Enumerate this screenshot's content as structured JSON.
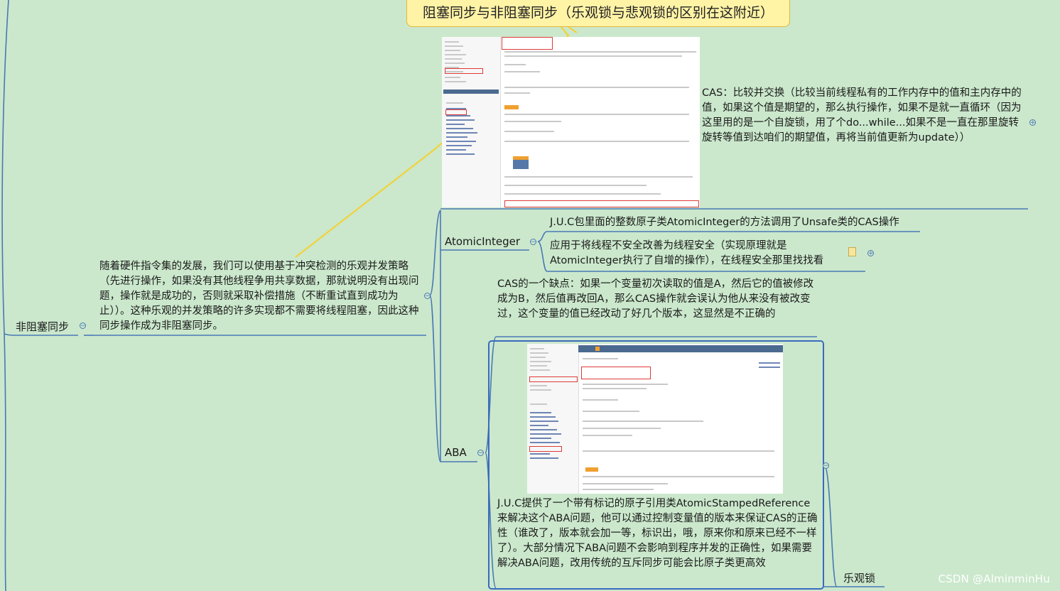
{
  "title": "阻塞同步与非阻塞同步（乐观锁与悲观锁的区别在这附近）",
  "left_node": {
    "label": "非阻塞同步"
  },
  "description": "随着硬件指令集的发展，我们可以使用基于冲突检测的乐观并发策略（先进行操作，如果没有其他线程争用共享数据，那就说明没有出现问题，操作就是成功的，否则就采取补偿措施（不断重试直到成功为止））。这种乐观的并发策略的许多实现都不需要将线程阻塞，因此这种同步操作成为非阻塞同步。",
  "cas_text": "CAS：比较并交换（比较当前线程私有的工作内存中的值和主内存中的值，如果这个值是期望的，那么执行操作，如果不是就一直循环（因为这里用的是一个自旋锁，用了个do...while...如果不是一直在那里旋转旋转等值到达咱们的期望值，再将当前值更新为update））",
  "atomic": {
    "label": "AtomicInteger",
    "items": [
      "J.U.C包里面的整数原子类AtomicInteger的方法调用了Unsafe类的CAS操作",
      "应用于将线程不安全改善为线程安全（实现原理就是AtomicInteger执行了自增的操作），在线程安全那里找找看"
    ]
  },
  "aba": {
    "label": "ABA",
    "defect": "CAS的一个缺点：如果一个变量初次读取的值是A，然后它的值被修改成为B，然后值再改回A，那么CAS操作就会误认为他从来没有被改变过，这个变量的值已经改动了好几个版本，这显然是不正确的",
    "solution": "J.U.C提供了一个带有标记的原子引用类AtomicStampedReference来解决这个ABA问题，他可以通过控制变量值的版本来保证CAS的正确性（谁改了，版本就会加一等，标识出，哦，原来你和原来已经不一样了）。大部分情况下ABA问题不会影响到程序并发的正确性，如果需要解决ABA问题，改用传统的互斥同步可能会比原子类更高效"
  },
  "bottom_node": {
    "label": "乐观锁"
  },
  "watermark": "CSDN @AlminminHu",
  "colors": {
    "background": "#cbe8cc",
    "branch_line": "#4a78b5",
    "title_fill": "#fff3a6",
    "title_border": "#e0b83a",
    "connector": "#f2d23a"
  }
}
